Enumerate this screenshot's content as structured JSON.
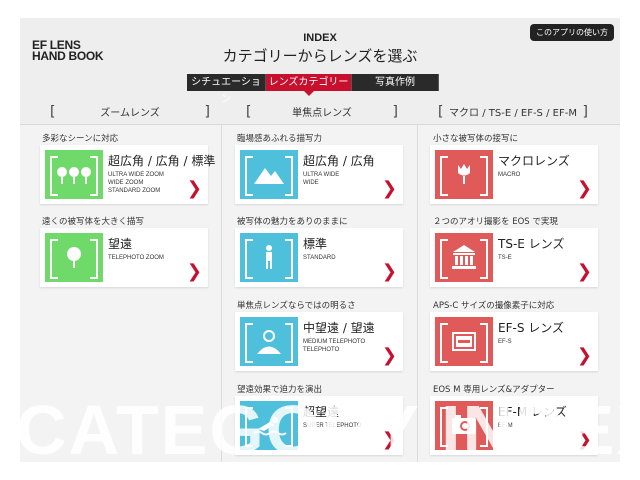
{
  "header": {
    "logo_line1": "EF LENS",
    "logo_line2": "HAND BOOK",
    "title_en": "INDEX",
    "title_ja": "カテゴリーからレンズを選ぶ",
    "help_label": "このアプリの使い方"
  },
  "tabs": [
    {
      "label": "シチュエーション",
      "active": false
    },
    {
      "label": "レンズカテゴリー",
      "active": true
    },
    {
      "label": "写真作例",
      "active": false
    }
  ],
  "columns": [
    {
      "header": "ズームレンズ"
    },
    {
      "header": "単焦点レンズ"
    },
    {
      "header": "マクロ / TS-E / EF-S / EF-M"
    }
  ],
  "cards": {
    "zoom_wide": {
      "section": "多彩なシーンに対応",
      "name": "超広角 / 広角 / 標準",
      "sub": "ULTRA WIDE ZOOM\nWIDE ZOOM\nSTANDARD ZOOM",
      "icon": "trees-icon"
    },
    "zoom_tele": {
      "section": "遠くの被写体を大きく描写",
      "name": "望遠",
      "sub": "TELEPHOTO ZOOM",
      "icon": "tree-icon"
    },
    "prime_wide": {
      "section": "臨場感あふれる描写力",
      "name": "超広角 / 広角",
      "sub": "ULTRA WIDE\nWIDE",
      "icon": "mountain-icon"
    },
    "prime_std": {
      "section": "被写体の魅力をありのままに",
      "name": "標準",
      "sub": "STANDARD",
      "icon": "person-icon"
    },
    "prime_mtele": {
      "section": "単焦点レンズならではの明るさ",
      "name": "中望遠 / 望遠",
      "sub": "MEDIUM TELEPHOTO\nTELEPHOTO",
      "icon": "portrait-icon"
    },
    "prime_stele": {
      "section": "望遠効果で迫力を演出",
      "name": "超望遠",
      "sub": "SUPER TELEPHOTO",
      "icon": "swimmer-icon"
    },
    "macro": {
      "section": "小さな被写体の接写に",
      "name": "マクロレンズ",
      "sub": "MACRO",
      "icon": "tulip-icon"
    },
    "tse": {
      "section": "２つのアオリ撮影を EOS で実現",
      "name": "TS-E レンズ",
      "sub": "TS-E",
      "icon": "building-icon"
    },
    "efs": {
      "section": "APS-C サイズの撮像素子に対応",
      "name": "EF-S レンズ",
      "sub": "EF-S",
      "icon": "apsc-sensor-icon"
    },
    "efm": {
      "section": "EOS M 専用レンズ&アダプター",
      "name": "EF-M レンズ",
      "sub": "EF-M",
      "icon": "camera-icon"
    }
  },
  "chevron": "❯",
  "watermark": "CATEGORY INDEX",
  "colors": {
    "accent": "#c8102e",
    "zoom": "#6fda69",
    "prime": "#4fc0dc",
    "special": "#e05a5a",
    "tab_bg": "#2a2a2a"
  }
}
